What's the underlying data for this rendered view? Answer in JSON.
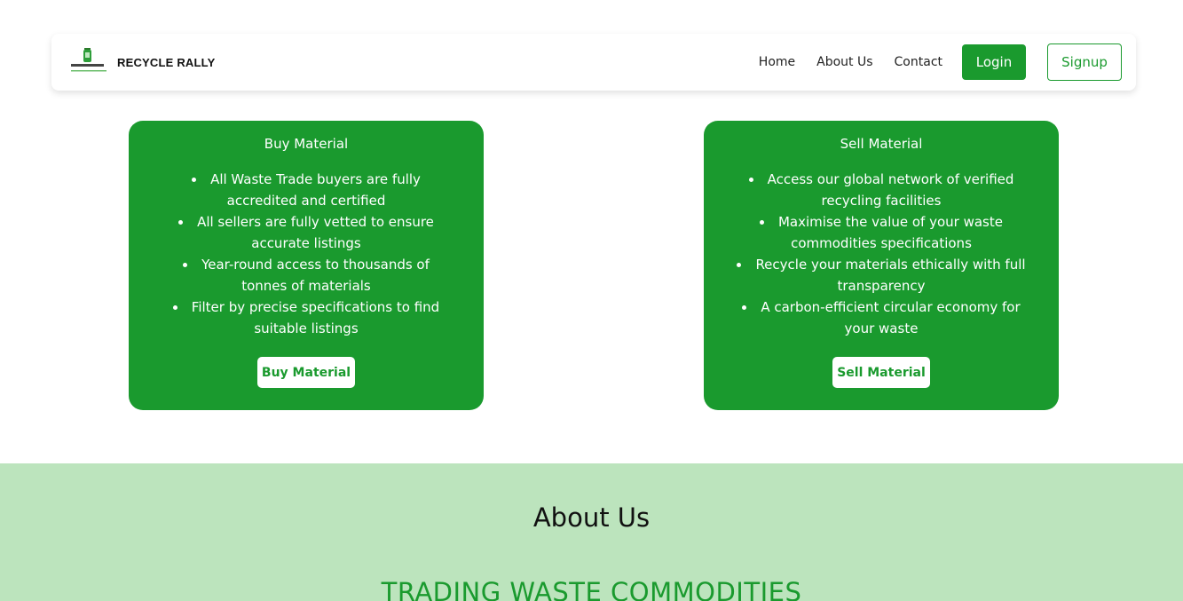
{
  "navbar": {
    "brand_name": "RECYCLE RALLY",
    "logo_caption": "RECYCLE RALLY",
    "links": [
      "Home",
      "About Us",
      "Contact"
    ],
    "login_label": "Login",
    "signup_label": "Signup"
  },
  "buy_card": {
    "title": "Buy Material",
    "items": [
      "All Waste Trade buyers are fully accredited and certified",
      "All sellers are fully vetted to ensure accurate listings",
      "Year-round access to thousands of tonnes of materials",
      "Filter by precise specifications to find suitable listings"
    ],
    "button_label": "Buy Material"
  },
  "sell_card": {
    "title": "Sell Material",
    "items": [
      "Access our global network of verified recycling facilities",
      "Maximise the value of your waste commodities specifications",
      "Recycle your materials ethically with full transparency",
      "A carbon-efficient circular economy for your waste"
    ],
    "button_label": "Sell Material"
  },
  "about": {
    "heading": "About Us",
    "subheading": "TRADING WASTE COMMODITIES"
  },
  "colors": {
    "brand_green": "#1a9a2e",
    "about_bg": "#bce4bd"
  }
}
